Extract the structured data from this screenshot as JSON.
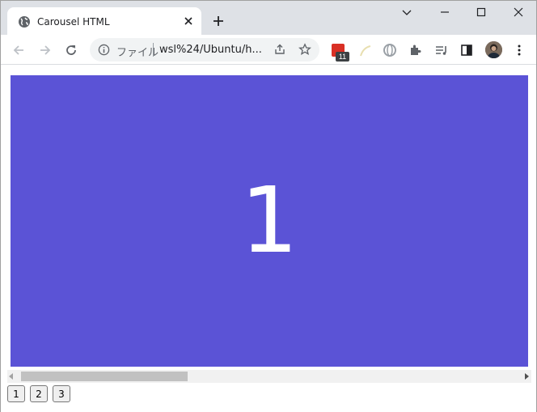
{
  "browser": {
    "tab": {
      "title": "Carousel HTML",
      "favicon": "globe-icon"
    },
    "omnibox": {
      "scheme_label": "ファイル",
      "url": "wsl%24/Ubuntu/h..."
    },
    "extensions": {
      "calendar_badge": "11"
    }
  },
  "page": {
    "current_slide_label": "1",
    "slide_color": "#5b53d6",
    "pager": [
      "1",
      "2",
      "3"
    ]
  }
}
